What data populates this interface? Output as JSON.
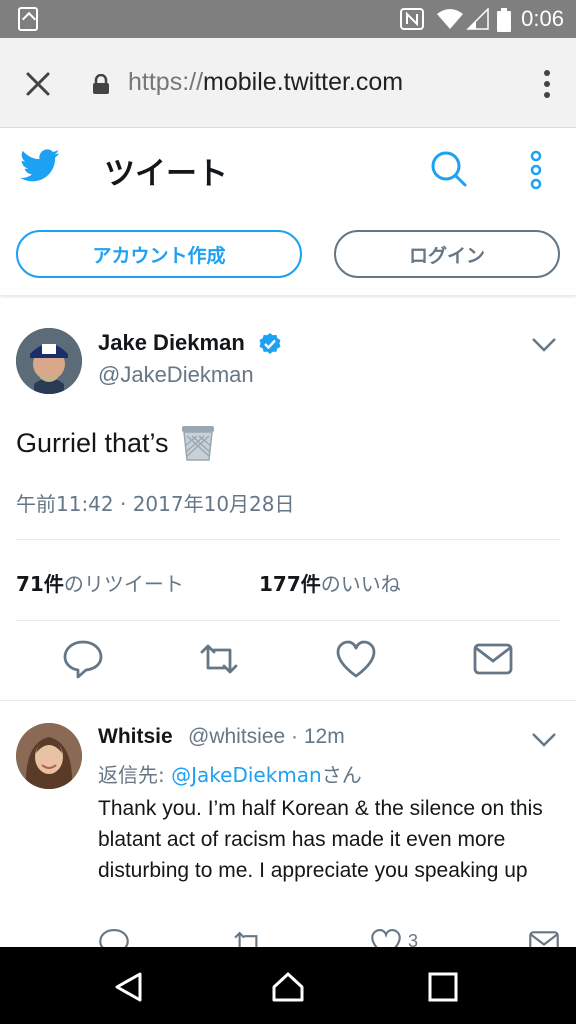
{
  "status_bar": {
    "time": "0:06"
  },
  "browser": {
    "url_scheme": "https://",
    "url_host": "mobile.twitter.com"
  },
  "header": {
    "title": "ツイート",
    "signup_label": "アカウント作成",
    "login_label": "ログイン"
  },
  "tweet": {
    "name": "Jake Diekman",
    "handle": "@JakeDiekman",
    "text": "Gurriel that’s",
    "date": "午前11:42 · 2017年10月28日",
    "retweet_count": "71件",
    "retweet_label": "のリツイート",
    "like_count": "177件",
    "like_label": "のいいね"
  },
  "reply": {
    "name": "Whitsie",
    "handle": "@whitsiee · 12m",
    "reply_to_prefix": "返信先: ",
    "reply_to_link": "@JakeDiekman",
    "reply_to_suffix": "さん",
    "text": "Thank you. I’m half Korean & the silence on this blatant act of racism has made it even more disturbing to me. I appreciate you speaking up",
    "like_count": "3"
  },
  "colors": {
    "accent": "#1da1f2",
    "muted": "#657786",
    "text": "#14171a"
  }
}
